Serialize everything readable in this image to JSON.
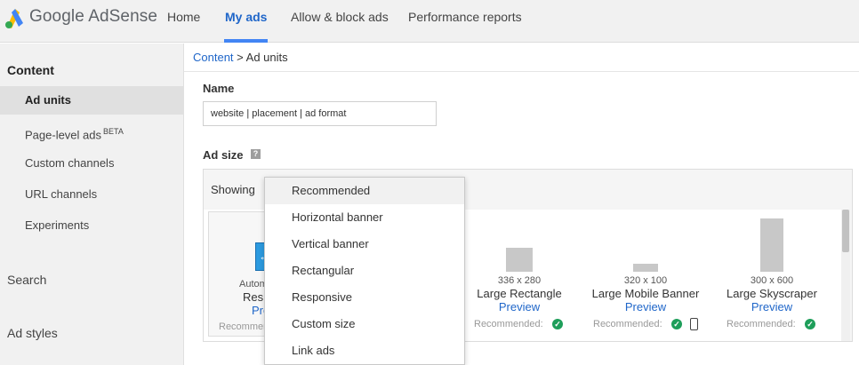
{
  "app": {
    "brand": "Google AdSense",
    "logo_icon": "adsense-logo-icon"
  },
  "nav": {
    "tabs": [
      {
        "label": "Home"
      },
      {
        "label": "My ads"
      },
      {
        "label": "Allow & block ads"
      },
      {
        "label": "Performance reports"
      }
    ],
    "active": "My ads"
  },
  "sidebar": {
    "content_heading": "Content",
    "items": [
      {
        "label": "Ad units"
      },
      {
        "label": "Page-level ads",
        "badge": "BETA"
      },
      {
        "label": "Custom channels"
      },
      {
        "label": "URL channels"
      },
      {
        "label": "Experiments"
      }
    ],
    "sections": [
      "Search",
      "Ad styles"
    ]
  },
  "breadcrumb": {
    "parent": "Content",
    "separator": ">",
    "current": "Ad units"
  },
  "form": {
    "name_label": "Name",
    "name_value": "website | placement | ad format",
    "ad_size_label": "Ad size",
    "help_icon": "?",
    "showing_label": "Showing"
  },
  "auto_card": {
    "line1": "Automa",
    "line2": "Resp",
    "preview": "Prev",
    "recommended": "Recommen"
  },
  "ad_sizes": [
    {
      "dims": "336 x 280",
      "name": "Large Rectangle",
      "preview": "Preview",
      "recommended": "Recommended:",
      "mobile": false
    },
    {
      "dims": "320 x 100",
      "name": "Large Mobile Banner",
      "preview": "Preview",
      "recommended": "Recommended:",
      "mobile": true
    },
    {
      "dims": "300 x 600",
      "name": "Large Skyscraper",
      "preview": "Preview",
      "recommended": "Recommended:",
      "mobile": false
    }
  ],
  "dropdown": {
    "options": [
      "Recommended",
      "Horizontal banner",
      "Vertical banner",
      "Rectangular",
      "Responsive",
      "Custom size",
      "Link ads"
    ],
    "selected": "Recommended"
  },
  "colors": {
    "accent": "#4285f4",
    "link": "#1f66c9",
    "check": "#1e9e5a"
  }
}
